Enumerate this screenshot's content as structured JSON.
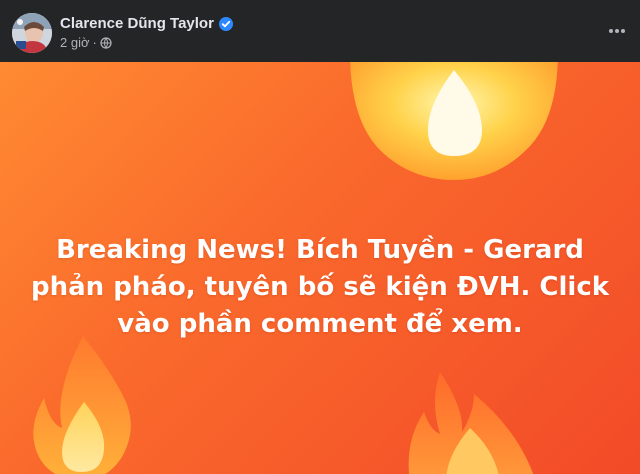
{
  "post": {
    "author": {
      "name": "Clarence Dũng Taylor",
      "verified": true
    },
    "timestamp": "2 giờ",
    "separator": "·",
    "privacy_icon": "globe-icon",
    "more_icon": "more-horizontal-icon",
    "banner": {
      "background_from": "#ff8a32",
      "background_to": "#f24a28",
      "headline": "Breaking News! Bích Tuyền - Gerard phản pháo, tuyên bố sẽ kiện ĐVH. Click vào phần comment để xem.",
      "decorations": [
        "fire-emoji-icon",
        "fire-emoji-icon",
        "fire-emoji-icon"
      ]
    }
  },
  "colors": {
    "header_bg": "#242526",
    "name_text": "#e4e6eb",
    "meta_text": "#b0b3b8",
    "verified_badge": "#2d88ff"
  }
}
